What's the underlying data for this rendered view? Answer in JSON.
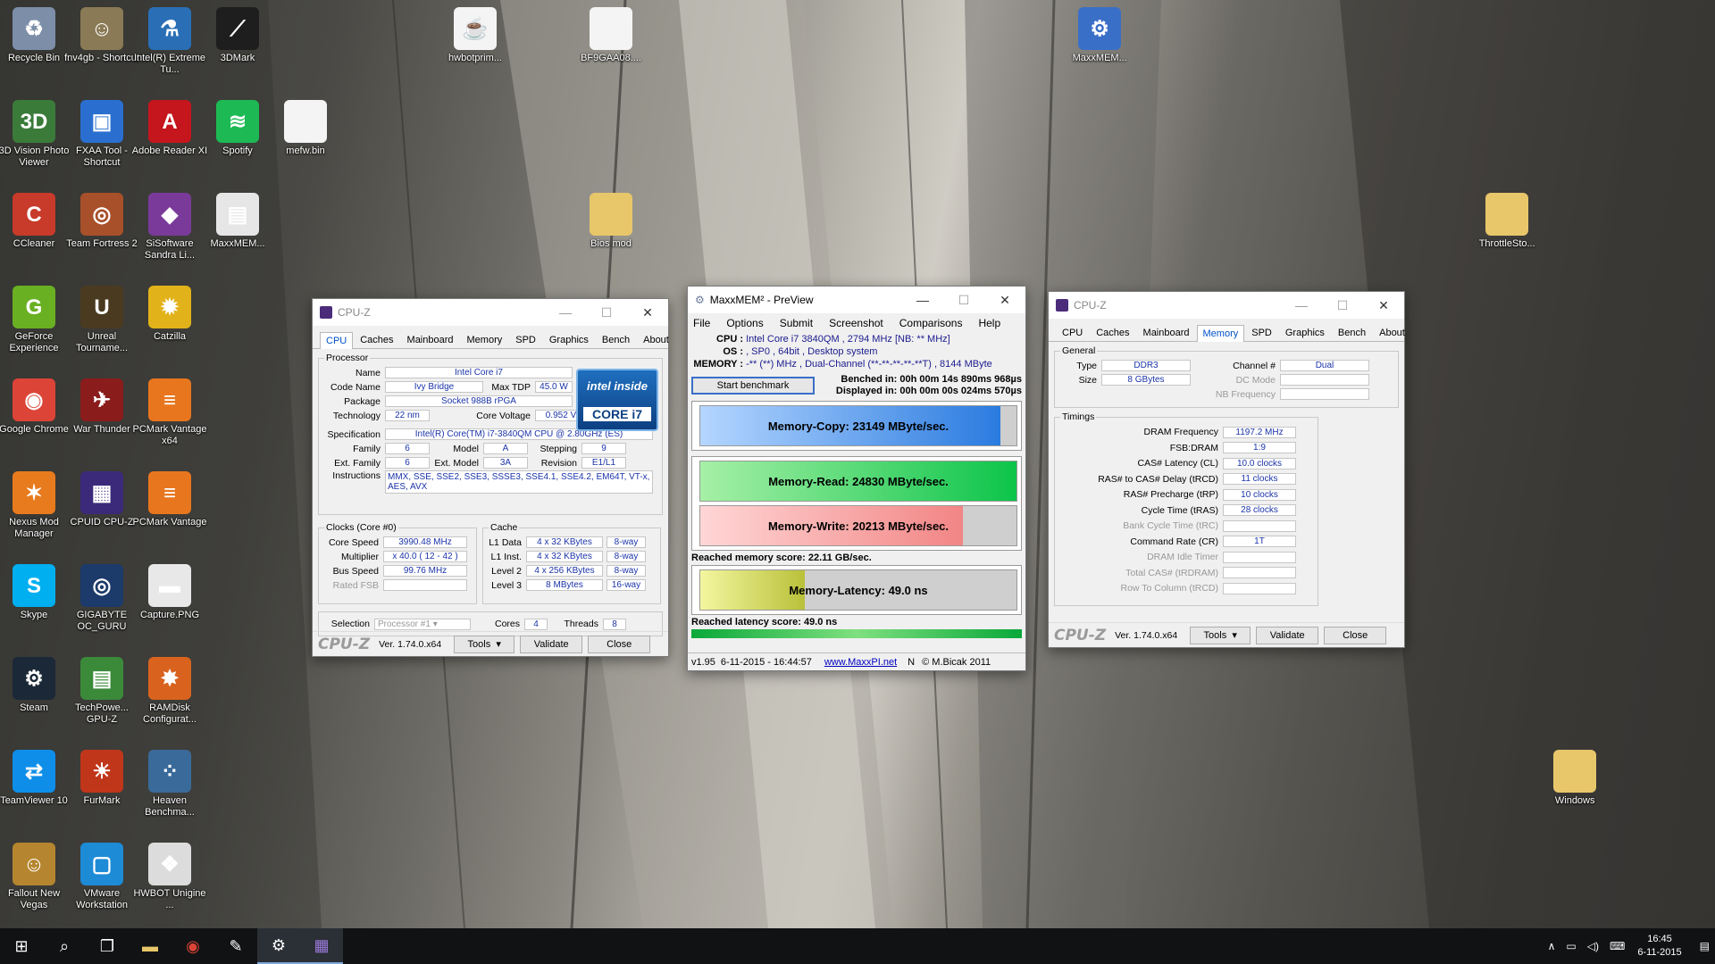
{
  "desktop_icons": [
    {
      "label": "Recycle Bin",
      "icon": "recycle-bin-icon",
      "color": "#7c8ea8",
      "glyph": "♻"
    },
    {
      "label": "3D Vision Photo Viewer",
      "icon": "3d-vision-icon",
      "color": "#3a7b3a",
      "glyph": "3D"
    },
    {
      "label": "CCleaner",
      "icon": "ccleaner-icon",
      "color": "#c83a2a",
      "glyph": "C"
    },
    {
      "label": "GeForce Experience",
      "icon": "geforce-icon",
      "color": "#6ab023",
      "glyph": "G"
    },
    {
      "label": "Google Chrome",
      "icon": "chrome-icon",
      "color": "#db4437",
      "glyph": "◉"
    },
    {
      "label": "Nexus Mod Manager",
      "icon": "nexus-icon",
      "color": "#e87b1e",
      "glyph": "✶"
    },
    {
      "label": "Skype",
      "icon": "skype-icon",
      "color": "#00aff0",
      "glyph": "S"
    },
    {
      "label": "Steam",
      "icon": "steam-icon",
      "color": "#1b2838",
      "glyph": "⚙"
    },
    {
      "label": "TeamViewer 10",
      "icon": "teamviewer-icon",
      "color": "#0e8ee9",
      "glyph": "⇄"
    },
    {
      "label": "Fallout New Vegas",
      "icon": "fallout-icon",
      "color": "#b5852f",
      "glyph": "☺"
    },
    {
      "label": "fnv4gb - Shortcut",
      "icon": "fnv4gb-icon",
      "color": "#8a7a55",
      "glyph": "☺"
    },
    {
      "label": "FXAA Tool - Shortcut",
      "icon": "fxaa-icon",
      "color": "#2a6fd0",
      "glyph": "▣"
    },
    {
      "label": "Team Fortress 2",
      "icon": "tf2-icon",
      "color": "#a8502a",
      "glyph": "◎"
    },
    {
      "label": "Unreal Tourname...",
      "icon": "unreal-icon",
      "color": "#4a3a20",
      "glyph": "U"
    },
    {
      "label": "War Thunder",
      "icon": "war-thunder-icon",
      "color": "#8a1c1c",
      "glyph": "✈"
    },
    {
      "label": "CPUID CPU-Z",
      "icon": "cpuz-icon",
      "color": "#3b2a7a",
      "glyph": "▦"
    },
    {
      "label": "GIGABYTE OC_GURU",
      "icon": "gigabyte-icon",
      "color": "#1c3a6a",
      "glyph": "◎"
    },
    {
      "label": "TechPowe... GPU-Z",
      "icon": "gpuz-icon",
      "color": "#3a8a3a",
      "glyph": "▤"
    },
    {
      "label": "FurMark",
      "icon": "furmark-icon",
      "color": "#c0361a",
      "glyph": "☀"
    },
    {
      "label": "VMware Workstation",
      "icon": "vmware-icon",
      "color": "#1d8bd6",
      "glyph": "▢"
    },
    {
      "label": "Intel(R) Extreme Tu...",
      "icon": "intel-xtu-icon",
      "color": "#2a6fb5",
      "glyph": "⚗"
    },
    {
      "label": "Adobe Reader XI",
      "icon": "adobe-reader-icon",
      "color": "#c4161c",
      "glyph": "A"
    },
    {
      "label": "SiSoftware Sandra Li...",
      "icon": "sandra-icon",
      "color": "#7a3a9a",
      "glyph": "◆"
    },
    {
      "label": "Catzilla",
      "icon": "catzilla-icon",
      "color": "#e2b21a",
      "glyph": "✹"
    },
    {
      "label": "PCMark Vantage x64",
      "icon": "pcmark-x64-icon",
      "color": "#e8761e",
      "glyph": "≡"
    },
    {
      "label": "PCMark Vantage",
      "icon": "pcmark-icon",
      "color": "#e8761e",
      "glyph": "≡"
    },
    {
      "label": "Capture.PNG",
      "icon": "png-file-icon",
      "color": "#e8e8e8",
      "glyph": "▬"
    },
    {
      "label": "RAMDisk Configurat...",
      "icon": "ramdisk-icon",
      "color": "#d9631e",
      "glyph": "✸"
    },
    {
      "label": "Heaven Benchma...",
      "icon": "heaven-icon",
      "color": "#3a6a9a",
      "glyph": "⁘"
    },
    {
      "label": "HWBOT Unigine ...",
      "icon": "hwbot-unigine-icon",
      "color": "#dcdcdc",
      "glyph": "❖"
    },
    {
      "label": "3DMark",
      "icon": "3dmark-icon",
      "color": "#1e1e1e",
      "glyph": "⟋"
    },
    {
      "label": "Spotify",
      "icon": "spotify-icon",
      "color": "#1db954",
      "glyph": "≋"
    },
    {
      "label": "MaxxMEM...",
      "icon": "maxxmem-file-icon",
      "color": "#e6e6e6",
      "glyph": "▤"
    },
    {
      "label": "mefw.bin",
      "icon": "bin-file-icon",
      "color": "#f4f4f4",
      "glyph": ""
    },
    {
      "label": "hwbotprim...",
      "icon": "java-file-icon",
      "color": "#f4f4f4",
      "glyph": "☕"
    },
    {
      "label": "BF9GAA08....",
      "icon": "file-icon",
      "color": "#f4f4f4",
      "glyph": ""
    },
    {
      "label": "Bios mod",
      "icon": "folder-icon",
      "color": "#e8c66a",
      "glyph": ""
    },
    {
      "label": "MaxxMEM...",
      "icon": "maxxmem-icon",
      "color": "#3a6fc8",
      "glyph": "⚙"
    },
    {
      "label": "ThrottleSto...",
      "icon": "folder-icon",
      "color": "#e8c66a",
      "glyph": ""
    },
    {
      "label": "Windows",
      "icon": "folder-icon",
      "color": "#e8c66a",
      "glyph": ""
    }
  ],
  "taskbar": {
    "apps": [
      "start-icon",
      "search-icon",
      "task-view-icon",
      "file-explorer-icon",
      "chrome-icon",
      "paint-icon",
      "maxxmem-icon",
      "cpuz-icon"
    ],
    "time": "16:45",
    "date": "6-11-2015"
  },
  "cpuz_left": {
    "title": "CPU-Z",
    "tabs": [
      "CPU",
      "Caches",
      "Mainboard",
      "Memory",
      "SPD",
      "Graphics",
      "Bench",
      "About"
    ],
    "selected_tab": "CPU",
    "processor_legend": "Processor",
    "name_label": "Name",
    "name": "Intel Core i7",
    "codename_label": "Code Name",
    "codename": "Ivy Bridge",
    "maxtdp_label": "Max TDP",
    "maxtdp": "45.0 W",
    "package_label": "Package",
    "package": "Socket 988B rPGA",
    "tech_label": "Technology",
    "tech": "22 nm",
    "corevolt_label": "Core Voltage",
    "corevolt": "0.952 V",
    "spec_label": "Specification",
    "spec": "Intel(R) Core(TM) i7-3840QM CPU @ 2.80GHz (ES)",
    "family_label": "Family",
    "family": "6",
    "model_label": "Model",
    "model": "A",
    "stepping_label": "Stepping",
    "stepping": "9",
    "extfamily_label": "Ext. Family",
    "extfamily": "6",
    "extmodel_label": "Ext. Model",
    "extmodel": "3A",
    "revision_label": "Revision",
    "revision": "E1/L1",
    "instr_label": "Instructions",
    "instr": "MMX, SSE, SSE2, SSE3, SSSE3, SSE4.1, SSE4.2, EM64T, VT-x, AES, AVX",
    "clocks_legend": "Clocks (Core #0)",
    "corespeed_label": "Core Speed",
    "corespeed": "3990.48 MHz",
    "mult_label": "Multiplier",
    "mult": "x 40.0 ( 12 - 42 )",
    "bus_label": "Bus Speed",
    "bus": "99.76 MHz",
    "fsb_label": "Rated FSB",
    "fsb": "",
    "cache_legend": "Cache",
    "l1d_label": "L1 Data",
    "l1d": "4 x 32 KBytes",
    "l1d_way": "8-way",
    "l1i_label": "L1 Inst.",
    "l1i": "4 x 32 KBytes",
    "l1i_way": "8-way",
    "l2_label": "Level 2",
    "l2": "4 x 256 KBytes",
    "l2_way": "8-way",
    "l3_label": "Level 3",
    "l3": "8 MBytes",
    "l3_way": "16-way",
    "selection_label": "Selection",
    "selection": "Processor #1",
    "cores_label": "Cores",
    "cores": "4",
    "threads_label": "Threads",
    "threads": "8",
    "intel_badge": "intel inside",
    "intel_core": "CORE i7",
    "logo": "CPU-Z",
    "version": "Ver. 1.74.0.x64",
    "tools": "Tools",
    "validate": "Validate",
    "close": "Close"
  },
  "maxxmem": {
    "title": "MaxxMEM² - PreView",
    "menu": [
      "File",
      "Options",
      "Submit",
      "Screenshot",
      "Comparisons",
      "Help"
    ],
    "cpu_label": "CPU :",
    "cpu": "Intel Core i7 3840QM , 2794 MHz  [NB: ** MHz]",
    "os_label": "OS :",
    "os": ", SP0 , 64bit , Desktop system",
    "mem_label": "MEMORY :",
    "mem": "-** (**) MHz , Dual-Channel (**-**-**-**-**T) , 8144 MByte",
    "start": "Start benchmark",
    "benched": "Benched in: 00h 00m 14s 890ms 968µs",
    "displayed": "Displayed in: 00h 00m 00s 024ms 570µs",
    "copy": "Memory-Copy: 23149 MByte/sec.",
    "copy_pct": 0.95,
    "read": "Memory-Read: 24830 MByte/sec.",
    "read_pct": 1.0,
    "write": "Memory-Write: 20213 MByte/sec.",
    "write_pct": 0.83,
    "score": "Reached memory score: 22.11 GB/sec.",
    "latency": "Memory-Latency: 49.0 ns",
    "latency_pct": 0.33,
    "lat_score": "Reached latency score: 49.0 ns",
    "status_ver": "v1.95",
    "status_date": "6-11-2015 - 16:44:57",
    "status_url": "www.MaxxPI.net",
    "status_n": "N",
    "status_copy": "© M.Bicak 2011"
  },
  "cpuz_right": {
    "title": "CPU-Z",
    "tabs": [
      "CPU",
      "Caches",
      "Mainboard",
      "Memory",
      "SPD",
      "Graphics",
      "Bench",
      "About"
    ],
    "selected_tab": "Memory",
    "general_legend": "General",
    "type_label": "Type",
    "type": "DDR3",
    "channel_label": "Channel #",
    "channel": "Dual",
    "size_label": "Size",
    "size": "8 GBytes",
    "dcmode_label": "DC Mode",
    "dcmode": "",
    "nbfreq_label": "NB Frequency",
    "nbfreq": "",
    "timings_legend": "Timings",
    "t": [
      {
        "label": "DRAM Frequency",
        "value": "1197.2 MHz",
        "grey": false
      },
      {
        "label": "FSB:DRAM",
        "value": "1:9",
        "grey": false
      },
      {
        "label": "CAS# Latency (CL)",
        "value": "10.0 clocks",
        "grey": false
      },
      {
        "label": "RAS# to CAS# Delay (tRCD)",
        "value": "11 clocks",
        "grey": false
      },
      {
        "label": "RAS# Precharge (tRP)",
        "value": "10 clocks",
        "grey": false
      },
      {
        "label": "Cycle Time (tRAS)",
        "value": "28 clocks",
        "grey": false
      },
      {
        "label": "Bank Cycle Time (tRC)",
        "value": "",
        "grey": true
      },
      {
        "label": "Command Rate (CR)",
        "value": "1T",
        "grey": false
      },
      {
        "label": "DRAM Idle Timer",
        "value": "",
        "grey": true
      },
      {
        "label": "Total CAS# (tRDRAM)",
        "value": "",
        "grey": true
      },
      {
        "label": "Row To Column (tRCD)",
        "value": "",
        "grey": true
      }
    ],
    "logo": "CPU-Z",
    "version": "Ver. 1.74.0.x64",
    "tools": "Tools",
    "validate": "Validate",
    "close": "Close"
  }
}
